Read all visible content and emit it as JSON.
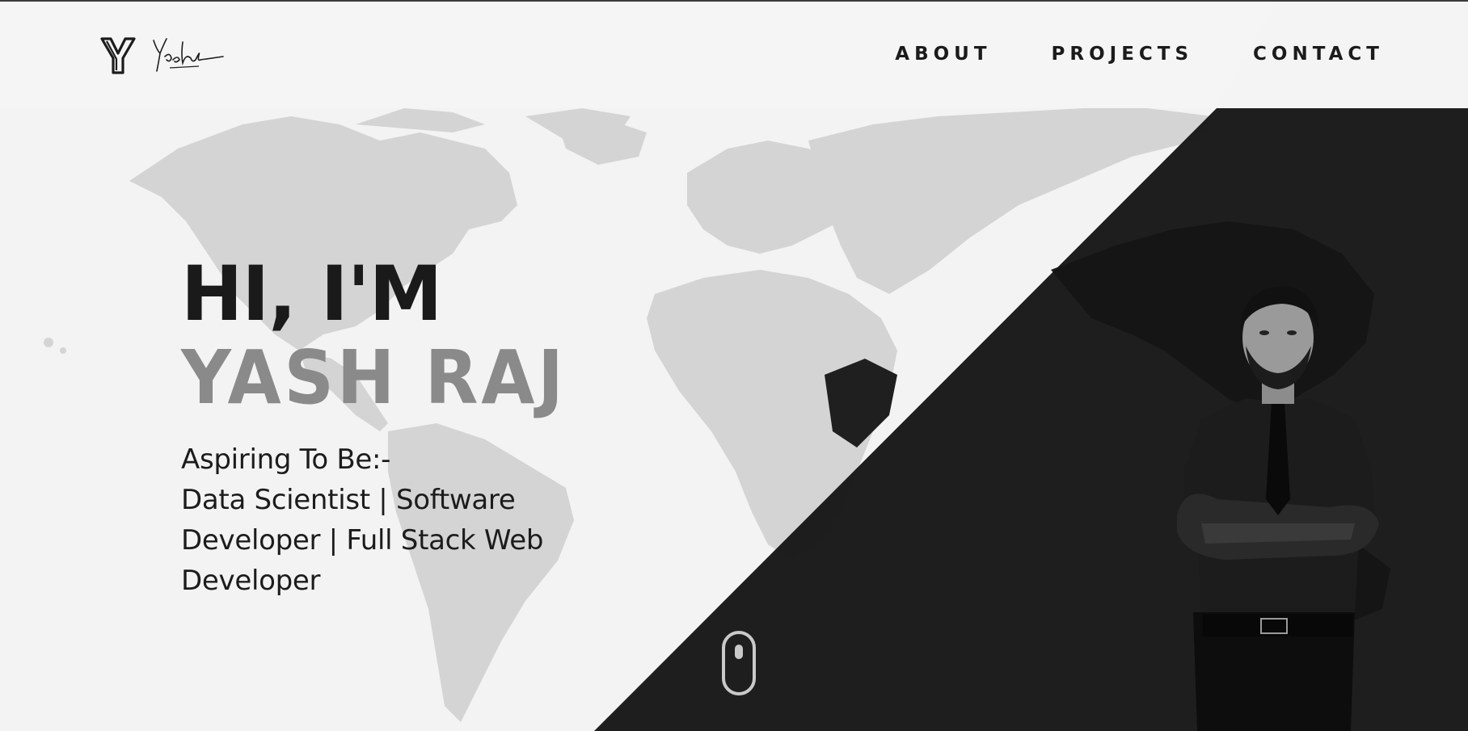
{
  "brand": {
    "logo_icon": "y-monogram-logo-icon",
    "signature_icon": "yash-signature-icon"
  },
  "nav": {
    "items": [
      {
        "label": "ABOUT"
      },
      {
        "label": "PROJECTS"
      },
      {
        "label": "CONTACT"
      }
    ]
  },
  "hero": {
    "greeting": "HI, I'M",
    "name": "YASH RAJ",
    "tagline_lines": [
      "Aspiring To Be:-",
      "Data Scientist | Software",
      "Developer | Full Stack Web",
      "Developer"
    ]
  },
  "scroll_indicator": {
    "icon": "mouse-scroll-icon"
  },
  "colors": {
    "background": "#f3f3f4",
    "dark_panel": "#151515",
    "text_dark": "#1a1a1a",
    "name_gray": "#8a8a8a",
    "map_light": "#d6d6d6",
    "map_dark": "#1f1f1f"
  }
}
